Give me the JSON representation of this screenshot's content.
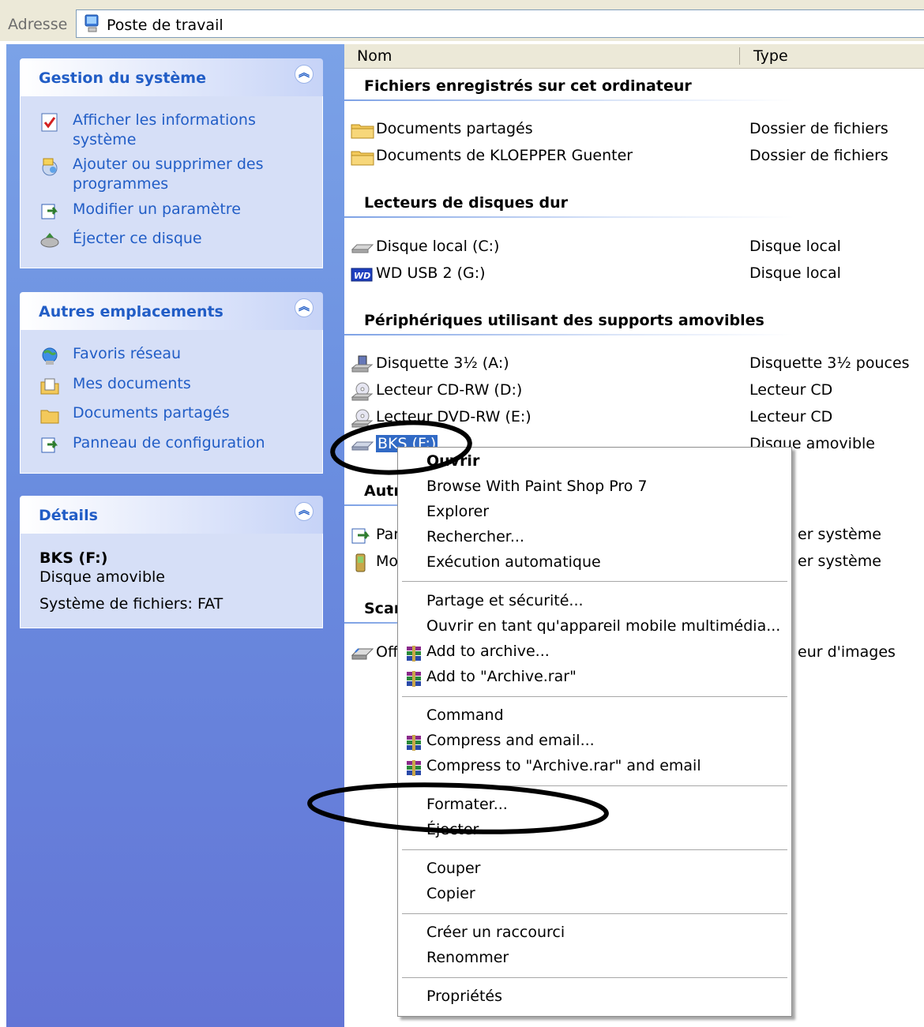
{
  "address": {
    "label": "Adresse",
    "value": "Poste de travail"
  },
  "taskpane": {
    "system": {
      "title": "Gestion du système",
      "tasks": [
        {
          "label_line1": "Afficher les informations",
          "label_line2": "système",
          "icon": "system-info-icon"
        },
        {
          "label_line1": "Ajouter ou supprimer des",
          "label_line2": "programmes",
          "icon": "add-remove-programs-icon"
        },
        {
          "label_line1": "Modifier un paramètre",
          "icon": "control-panel-icon"
        },
        {
          "label_line1": "Éjecter ce disque",
          "icon": "eject-disk-icon"
        }
      ]
    },
    "places": {
      "title": "Autres emplacements",
      "items": [
        {
          "label": "Favoris réseau",
          "icon": "network-places-icon"
        },
        {
          "label": "Mes documents",
          "icon": "my-documents-icon"
        },
        {
          "label": "Documents partagés",
          "icon": "shared-folder-icon"
        },
        {
          "label": "Panneau de configuration",
          "icon": "control-panel-icon"
        }
      ]
    },
    "details": {
      "title": "Détails",
      "name": "BKS (F:)",
      "type": "Disque amovible",
      "fs": "Système de fichiers: FAT"
    }
  },
  "listview": {
    "columns": {
      "name": "Nom",
      "type": "Type"
    },
    "groups": [
      {
        "title": "Fichiers enregistrés sur cet ordinateur"
      },
      {
        "title": "Lecteurs de disques dur"
      },
      {
        "title": "Périphériques utilisant des supports amovibles"
      },
      {
        "title": "Autr"
      },
      {
        "title": "Scar"
      }
    ],
    "items": [
      {
        "name": "Documents partagés",
        "type": "Dossier de fichiers",
        "icon": "folder-icon"
      },
      {
        "name": "Documents de KLOEPPER Guenter",
        "type": "Dossier de fichiers",
        "icon": "folder-icon"
      },
      {
        "name": "Disque local (C:)",
        "type": "Disque local",
        "icon": "hard-drive-icon"
      },
      {
        "name": "WD USB 2 (G:)",
        "type": "Disque local",
        "icon": "wd-drive-icon"
      },
      {
        "name": "Disquette 3½ (A:)",
        "type": "Disquette 3½ pouces",
        "icon": "floppy-icon"
      },
      {
        "name": "Lecteur CD-RW (D:)",
        "type": "Lecteur CD",
        "icon": "cd-drive-icon"
      },
      {
        "name": "Lecteur DVD-RW (E:)",
        "type": "Lecteur CD",
        "icon": "dvd-drive-icon"
      },
      {
        "name": "BKS (F:)",
        "type": "Disque amovible",
        "icon": "removable-drive-icon"
      },
      {
        "name": "Par",
        "type": "er système",
        "icon": "control-panel-icon"
      },
      {
        "name": "Mo",
        "type": "er système",
        "icon": "mobile-device-icon"
      },
      {
        "name": "Off",
        "type": "eur d'images",
        "icon": "scanner-icon"
      }
    ]
  },
  "context_menu": {
    "items": [
      {
        "label": "Ouvrir",
        "bold": true
      },
      {
        "label": "Browse With Paint Shop Pro 7"
      },
      {
        "label": "Explorer"
      },
      {
        "label": "Rechercher..."
      },
      {
        "label": "Exécution automatique"
      },
      {
        "label": "Partage et sécurité..."
      },
      {
        "label": "Ouvrir en tant qu'appareil mobile multimédia..."
      },
      {
        "label": "Add to archive...",
        "icon": "winrar-icon"
      },
      {
        "label": "Add to \"Archive.rar\"",
        "icon": "winrar-icon"
      },
      {
        "label": "Command"
      },
      {
        "label": "Compress and email...",
        "icon": "winrar-icon"
      },
      {
        "label": "Compress to \"Archive.rar\" and email",
        "icon": "winrar-icon"
      },
      {
        "label": "Formater..."
      },
      {
        "label": "Éjecter"
      },
      {
        "label": "Couper"
      },
      {
        "label": "Copier"
      },
      {
        "label": "Créer un raccourci"
      },
      {
        "label": "Renommer"
      },
      {
        "label": "Propriétés"
      }
    ]
  },
  "colors": {
    "link": "#215dc6",
    "selection": "#316ac5",
    "pane": "#6b8fe0"
  }
}
